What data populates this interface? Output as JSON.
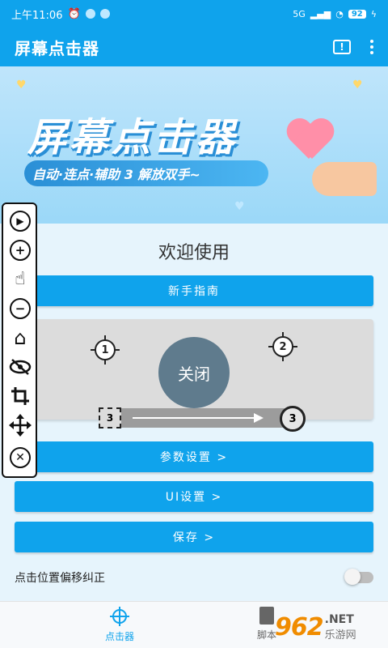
{
  "status_bar": {
    "time": "上午11:06",
    "network": "5G",
    "battery": "92"
  },
  "app_bar": {
    "title": "屏幕点击器"
  },
  "banner": {
    "title": "屏幕点击器",
    "tagline": "自动·连点·辅助 3 解放双手~"
  },
  "main": {
    "welcome": "欢迎使用",
    "guide_button": "新手指南",
    "preview": {
      "close_label": "关闭",
      "target_1": "1",
      "target_2": "2",
      "swipe_start": "3",
      "swipe_end": "3"
    },
    "params_button": "参数设置 >",
    "ui_button": "UI设置 >",
    "save_button": "保存 >",
    "offset_toggle": {
      "label": "点击位置偏移纠正",
      "enabled": false
    }
  },
  "floating_toolbar": {
    "items": [
      {
        "icon": "play-icon"
      },
      {
        "icon": "add-icon"
      },
      {
        "icon": "tap-hand-icon"
      },
      {
        "icon": "remove-icon"
      },
      {
        "icon": "home-icon"
      },
      {
        "icon": "hide-icon"
      },
      {
        "icon": "crop-icon"
      },
      {
        "icon": "move-icon"
      },
      {
        "icon": "close-icon"
      }
    ]
  },
  "bottom_nav": {
    "items": [
      {
        "label": "点击器",
        "icon": "crosshair-icon",
        "active": true
      },
      {
        "label": "脚本",
        "icon": "document-icon",
        "active": false
      }
    ]
  },
  "watermark": {
    "logo": "962",
    "net": ".NET",
    "cn": "乐游网"
  },
  "colors": {
    "primary": "#0fa3ec",
    "background": "#e6f4fc",
    "close_button": "#5f7b8d"
  }
}
